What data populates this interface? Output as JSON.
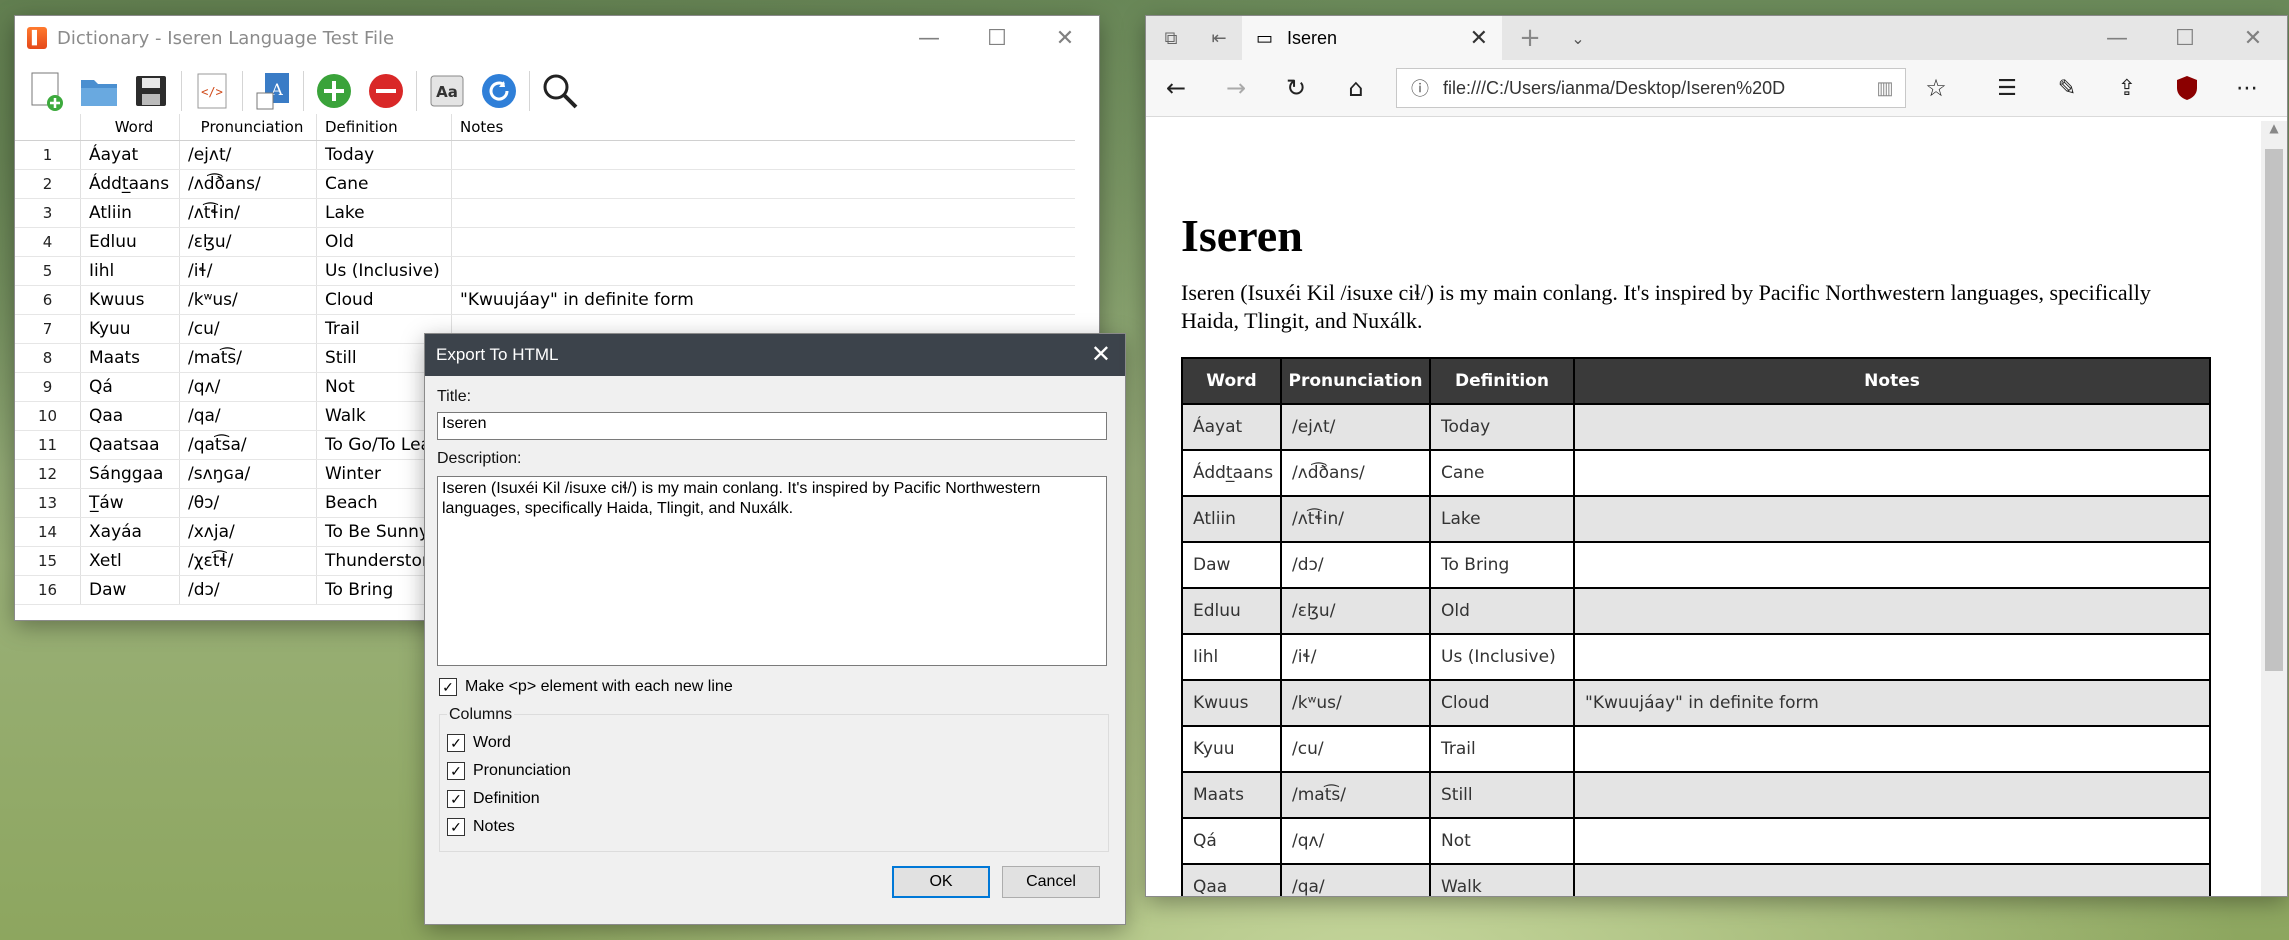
{
  "dictionary_window": {
    "title": "Dictionary - Iseren Language Test File",
    "columns": [
      "Word",
      "Pronunciation",
      "Definition",
      "Notes"
    ],
    "rows": [
      {
        "num": "1",
        "word": "Áayat",
        "pron": "/ejʌt/",
        "def": "Today",
        "notes": ""
      },
      {
        "num": "2",
        "word": "Áddt̲aans",
        "pron": "/ʌd͡ðans/",
        "def": "Cane",
        "notes": ""
      },
      {
        "num": "3",
        "word": "Atliin",
        "pron": "/ʌt͡ɬin/",
        "def": "Lake",
        "notes": ""
      },
      {
        "num": "4",
        "word": "Edluu",
        "pron": "/ɛɮu/",
        "def": "Old",
        "notes": ""
      },
      {
        "num": "5",
        "word": "Iihl",
        "pron": "/iɬ/",
        "def": "Us (Inclusive)",
        "notes": ""
      },
      {
        "num": "6",
        "word": "Kwuus",
        "pron": "/kʷus/",
        "def": "Cloud",
        "notes": "\"Kwuujáay\" in definite form"
      },
      {
        "num": "7",
        "word": "Kyuu",
        "pron": "/cu/",
        "def": "Trail",
        "notes": ""
      },
      {
        "num": "8",
        "word": "Maats",
        "pron": "/mat͡s/",
        "def": "Still",
        "notes": ""
      },
      {
        "num": "9",
        "word": "Qá",
        "pron": "/qʌ/",
        "def": "Not",
        "notes": ""
      },
      {
        "num": "10",
        "word": "Qaa",
        "pron": "/qa/",
        "def": "Walk",
        "notes": ""
      },
      {
        "num": "11",
        "word": "Qaatsaa",
        "pron": "/qat͡sa/",
        "def": "To Go/To Leave",
        "notes": ""
      },
      {
        "num": "12",
        "word": "Sánggaa",
        "pron": "/sʌŋɢa/",
        "def": "Winter",
        "notes": ""
      },
      {
        "num": "13",
        "word": "T̲áw",
        "pron": "/θɔ/",
        "def": "Beach",
        "notes": ""
      },
      {
        "num": "14",
        "word": "Xayáa",
        "pron": "/xʌja/",
        "def": "To Be Sunny",
        "notes": ""
      },
      {
        "num": "15",
        "word": "Xetl",
        "pron": "/χɛt͡ɬ/",
        "def": "Thunderstorm",
        "notes": ""
      },
      {
        "num": "16",
        "word": "Daw",
        "pron": "/dɔ/",
        "def": "To Bring",
        "notes": ""
      }
    ]
  },
  "export_dialog": {
    "title": "Export To HTML",
    "title_label": "Title:",
    "title_value": "Iseren",
    "description_label": "Description:",
    "description_value": "Iseren (Isuxéi Kil /isuxe ciɬ/) is my main conlang. It's inspired by Pacific Northwestern languages, specifically Haida, Tlingit, and Nuxálk.",
    "make_p_label": "Make <p> element with each new line",
    "columns_group_label": "Columns",
    "column_options": [
      "Word",
      "Pronunciation",
      "Definition",
      "Notes"
    ],
    "ok_label": "OK",
    "cancel_label": "Cancel"
  },
  "browser": {
    "tab_title": "Iseren",
    "url": "file:///C:/Users/ianma/Desktop/Iseren%20D",
    "page_title": "Iseren",
    "page_description": "Iseren (Isuxéi Kil /isuxe ciɬ/) is my main conlang. It's inspired by Pacific Northwestern languages, specifically Haida, Tlingit, and Nuxálk.",
    "table_headers": [
      "Word",
      "Pronunciation",
      "Definition",
      "Notes"
    ],
    "table_rows": [
      {
        "word": "Áayat",
        "pron": "/ejʌt/",
        "def": "Today",
        "notes": ""
      },
      {
        "word": "Áddt̲aans",
        "pron": "/ʌd͡ðans/",
        "def": "Cane",
        "notes": ""
      },
      {
        "word": "Atliin",
        "pron": "/ʌt͡ɬin/",
        "def": "Lake",
        "notes": ""
      },
      {
        "word": "Daw",
        "pron": "/dɔ/",
        "def": "To Bring",
        "notes": ""
      },
      {
        "word": "Edluu",
        "pron": "/ɛɮu/",
        "def": "Old",
        "notes": ""
      },
      {
        "word": "Iihl",
        "pron": "/iɬ/",
        "def": "Us (Inclusive)",
        "notes": ""
      },
      {
        "word": "Kwuus",
        "pron": "/kʷus/",
        "def": "Cloud",
        "notes": "\"Kwuujáay\" in definite form"
      },
      {
        "word": "Kyuu",
        "pron": "/cu/",
        "def": "Trail",
        "notes": ""
      },
      {
        "word": "Maats",
        "pron": "/mat͡s/",
        "def": "Still",
        "notes": ""
      },
      {
        "word": "Qá",
        "pron": "/qʌ/",
        "def": "Not",
        "notes": ""
      },
      {
        "word": "Qaa",
        "pron": "/qa/",
        "def": "Walk",
        "notes": ""
      }
    ]
  }
}
